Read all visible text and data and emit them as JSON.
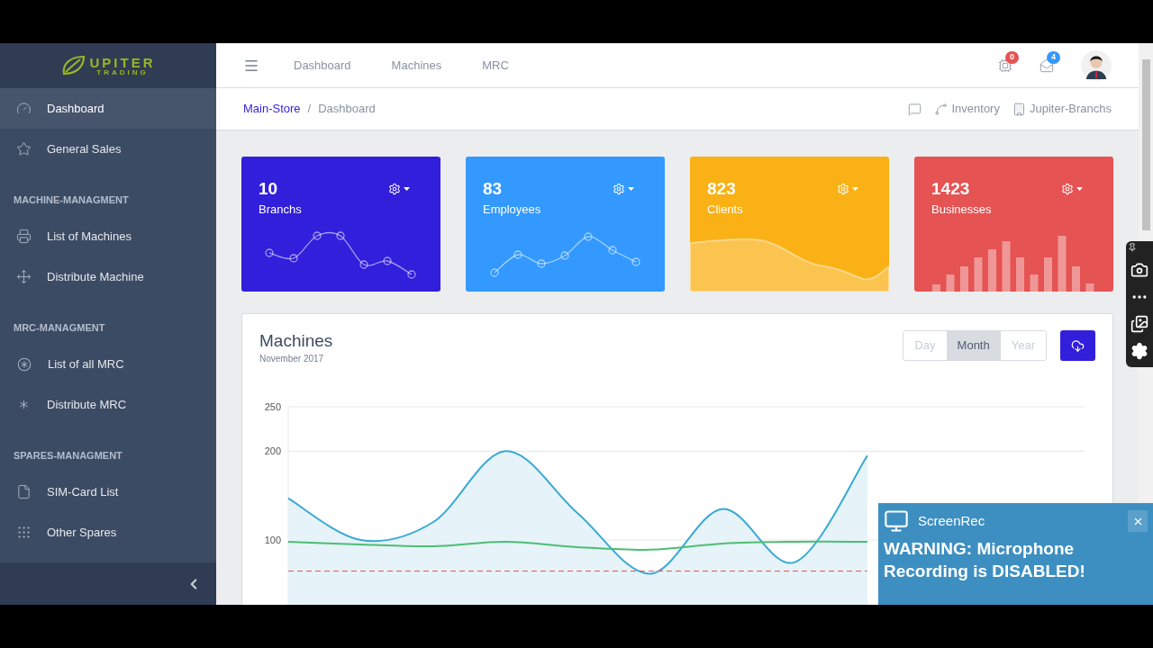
{
  "sidebar": {
    "logo": {
      "initial_word": "UPITER",
      "subtitle": "TRADING"
    },
    "groups": [
      {
        "items": [
          {
            "label": "Dashboard",
            "selected": true
          },
          {
            "label": "General Sales",
            "selected": false
          }
        ]
      },
      {
        "heading": "MACHINE-MANAGMENT",
        "items": [
          {
            "label": "List of Machines",
            "selected": false
          },
          {
            "label": "Distribute Machine",
            "selected": false
          }
        ]
      },
      {
        "heading": "MRC-MANAGMENT",
        "items": [
          {
            "label": "List of all MRC",
            "selected": false
          },
          {
            "label": "Distribute MRC",
            "selected": false
          }
        ]
      },
      {
        "heading": "SPARES-MANAGMENT",
        "items": [
          {
            "label": "SIM-Card List",
            "selected": false
          },
          {
            "label": "Other Spares",
            "selected": false
          }
        ]
      }
    ]
  },
  "header": {
    "nav": [
      "Dashboard",
      "Machines",
      "MRC"
    ],
    "notifications": [
      {
        "kind": "chip",
        "count": "0",
        "color": "#e55353"
      },
      {
        "kind": "mail",
        "count": "4",
        "color": "#39f"
      }
    ]
  },
  "breadcrumb": {
    "items": [
      "Main-Store",
      "Dashboard"
    ],
    "separator": "/",
    "actions": [
      {
        "kind": "chat"
      },
      {
        "kind": "graph",
        "label": "Inventory"
      },
      {
        "kind": "building",
        "label": "Jupiter-Branchs"
      }
    ]
  },
  "widgets": [
    {
      "value": "10",
      "label": "Branchs",
      "kind": "line",
      "color": "#321fdb"
    },
    {
      "value": "83",
      "label": "Employees",
      "kind": "line",
      "color": "#39f"
    },
    {
      "value": "823",
      "label": "Clients",
      "kind": "area",
      "color": "#f9b115"
    },
    {
      "value": "1423",
      "label": "Businesses",
      "kind": "bar",
      "color": "#e55353"
    }
  ],
  "machines_card": {
    "title": "Machines",
    "subtitle": "November 2017",
    "periods": [
      {
        "label": "Day",
        "selected": false
      },
      {
        "label": "Month",
        "selected": true
      },
      {
        "label": "Year",
        "selected": false
      }
    ],
    "chart_data": {
      "type": "line",
      "ylim": [
        0,
        250
      ],
      "yticks": [
        100,
        200,
        250
      ],
      "series": [
        {
          "type": "area",
          "color": "#39a9d4",
          "values": [
            147,
            100,
            120,
            200,
            130,
            62,
            135,
            75,
            195,
            null,
            null,
            null
          ]
        },
        {
          "type": "line",
          "color": "#4dbd74",
          "values": [
            98,
            95,
            93,
            98,
            92,
            89,
            96,
            98,
            98,
            null,
            null,
            null
          ]
        },
        {
          "type": "line",
          "line_style": "dashed",
          "color": "#e55353",
          "values": [
            65,
            65,
            65,
            65,
            65,
            65,
            65,
            65,
            65,
            null,
            null,
            null
          ]
        }
      ]
    }
  },
  "recorder_popup": {
    "app": "ScreenRec",
    "message": "WARNING: Microphone Recording is DISABLED!"
  }
}
